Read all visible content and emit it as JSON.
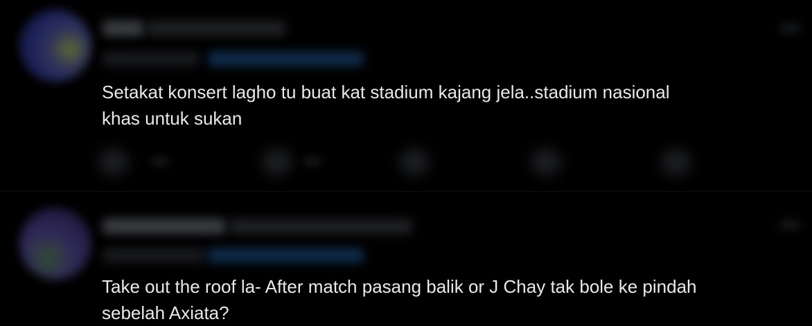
{
  "replies": [
    {
      "text_lines": [
        "Setakat konsert lagho tu buat kat stadium kajang jela..stadium nasional",
        "khas untuk sukan"
      ]
    },
    {
      "text_lines": [
        "Take out the roof la- After match pasang balik or J Chay tak bole ke pindah",
        "sebelah Axiata?"
      ]
    }
  ],
  "colors": {
    "background": "#000000",
    "text": "#e7e9ea",
    "mention_link": "#1d9bf0"
  },
  "icons": [
    "reply-icon",
    "retweet-icon",
    "like-icon",
    "share-icon",
    "more-icon"
  ]
}
